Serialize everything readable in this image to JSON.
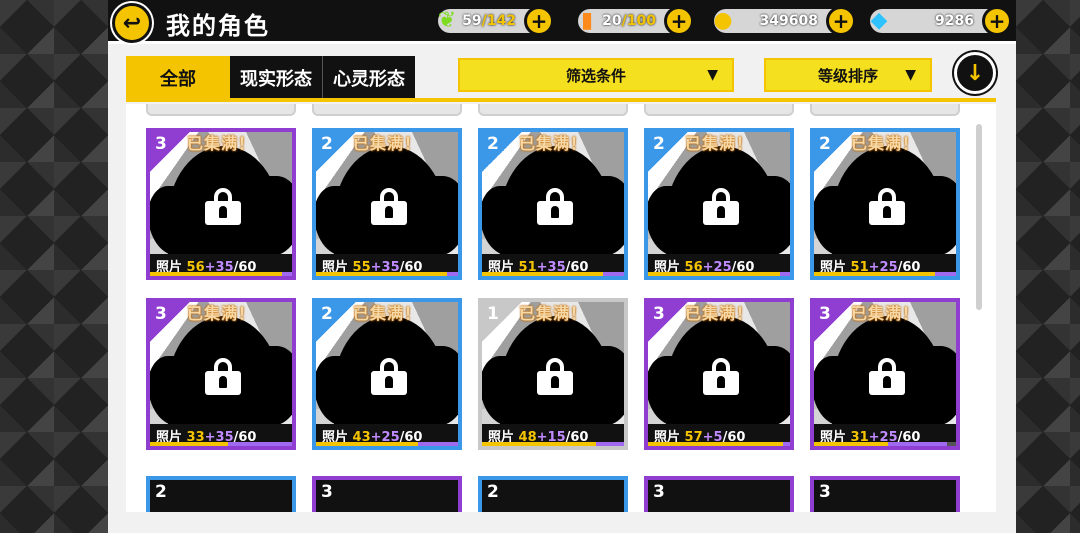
{
  "header": {
    "title": "我的角色",
    "resources": [
      {
        "name": "energy",
        "icon": "leaf-icon",
        "value": "59",
        "max": "/142"
      },
      {
        "name": "stamina",
        "icon": "battery-icon",
        "value": "20",
        "max": "/100"
      },
      {
        "name": "coins",
        "icon": "coin-icon",
        "value": "349608",
        "max": ""
      },
      {
        "name": "gems",
        "icon": "gem-icon",
        "value": "9286",
        "max": ""
      }
    ]
  },
  "tabs": [
    {
      "label": "全部",
      "active": true
    },
    {
      "label": "现实形态",
      "active": false
    },
    {
      "label": "心灵形态",
      "active": false
    }
  ],
  "filter": {
    "label": "筛选条件",
    "caret": "▼"
  },
  "sort": {
    "label": "等级排序",
    "caret": "▼"
  },
  "sort_toggle_icon": "↓",
  "card_labels": {
    "collected": "已集满！",
    "photo": "照片"
  },
  "cards": [
    {
      "rarity": "3",
      "cur": "56",
      "add": "+35",
      "total": "/60",
      "pct": 0.93,
      "pct2": 0.07
    },
    {
      "rarity": "2",
      "cur": "55",
      "add": "+35",
      "total": "/60",
      "pct": 0.92,
      "pct2": 0.08
    },
    {
      "rarity": "2",
      "cur": "51",
      "add": "+35",
      "total": "/60",
      "pct": 0.85,
      "pct2": 0.15
    },
    {
      "rarity": "2",
      "cur": "56",
      "add": "+25",
      "total": "/60",
      "pct": 0.93,
      "pct2": 0.07
    },
    {
      "rarity": "2",
      "cur": "51",
      "add": "+25",
      "total": "/60",
      "pct": 0.85,
      "pct2": 0.15
    },
    {
      "rarity": "3",
      "cur": "33",
      "add": "+35",
      "total": "/60",
      "pct": 0.55,
      "pct2": 0.45
    },
    {
      "rarity": "2",
      "cur": "43",
      "add": "+25",
      "total": "/60",
      "pct": 0.72,
      "pct2": 0.28
    },
    {
      "rarity": "1",
      "cur": "48",
      "add": "+15",
      "total": "/60",
      "pct": 0.8,
      "pct2": 0.2
    },
    {
      "rarity": "3",
      "cur": "57",
      "add": "+5",
      "total": "/60",
      "pct": 0.95,
      "pct2": 0.05
    },
    {
      "rarity": "3",
      "cur": "31",
      "add": "+25",
      "total": "/60",
      "pct": 0.52,
      "pct2": 0.42
    }
  ],
  "partial_cards": [
    {
      "rarity": "2"
    },
    {
      "rarity": "3"
    },
    {
      "rarity": "2"
    },
    {
      "rarity": "3"
    },
    {
      "rarity": "3"
    }
  ],
  "colors": {
    "accent": "#f5c400",
    "rarity3": "#8f3ed1",
    "rarity2": "#3b97e8",
    "rarity1": "#c8c8c8"
  }
}
